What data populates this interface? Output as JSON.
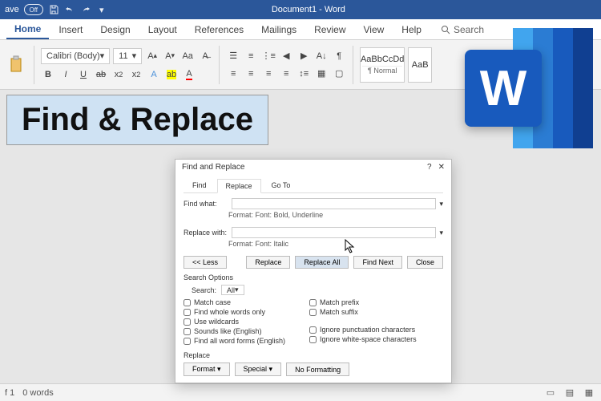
{
  "titlebar": {
    "autosave_label": "ave",
    "autosave_state": "Off",
    "doc_title": "Document1 - Word"
  },
  "tabs": {
    "items": [
      "Home",
      "Insert",
      "Design",
      "Layout",
      "References",
      "Mailings",
      "Review",
      "View",
      "Help"
    ],
    "active": 0,
    "search_label": "Search"
  },
  "ribbon": {
    "font_name": "Calibri (Body)",
    "font_size": "11",
    "styles": [
      {
        "sample": "AaBbCcDd",
        "label": "¶ Normal"
      },
      {
        "sample": "AaB",
        "label": ""
      }
    ]
  },
  "overlay": {
    "title": "Find & Replace"
  },
  "logo": {
    "letter": "W"
  },
  "dialog": {
    "title": "Find and Replace",
    "tabs": [
      "Find",
      "Replace",
      "Go To"
    ],
    "active_tab": 1,
    "find_label": "Find what:",
    "find_value": "",
    "find_format_label": "Format:",
    "find_format_value": "Font: Bold, Underline",
    "replace_label": "Replace with:",
    "replace_value": "",
    "replace_format_label": "Format:",
    "replace_format_value": "Font: Italic",
    "less_btn": "<< Less",
    "buttons": {
      "replace": "Replace",
      "replace_all": "Replace All",
      "find_next": "Find Next",
      "close": "Close"
    },
    "search_options_title": "Search Options",
    "search_label": "Search:",
    "search_scope": "All",
    "checkboxes_left": [
      "Match case",
      "Find whole words only",
      "Use wildcards",
      "Sounds like (English)",
      "Find all word forms (English)"
    ],
    "checkboxes_right": [
      "Match prefix",
      "Match suffix",
      "Ignore punctuation characters",
      "Ignore white-space characters"
    ],
    "replace_section_title": "Replace",
    "replace_buttons": [
      "Format ▾",
      "Special ▾",
      "No Formatting"
    ]
  },
  "statusbar": {
    "page": "f 1",
    "words": "0 words"
  }
}
